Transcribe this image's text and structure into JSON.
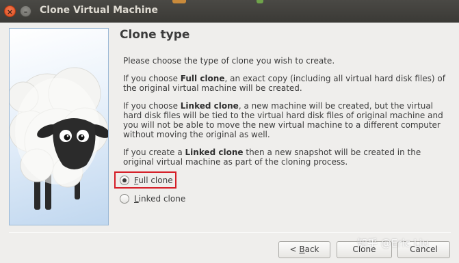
{
  "window": {
    "title": "Clone Virtual Machine",
    "close_glyph": "×",
    "minimize_glyph": "–"
  },
  "heading": "Clone type",
  "paragraphs": {
    "intro": "Please choose the type of clone you wish to create.",
    "full_prefix": "If you choose ",
    "full_term": "Full clone",
    "full_suffix": ", an exact copy (including all virtual hard disk files) of the original virtual machine will be created.",
    "linked_prefix": "If you choose ",
    "linked_term": "Linked clone",
    "linked_suffix": ", a new machine will be created, but the virtual hard disk files will be tied to the virtual hard disk files of original machine and you will not be able to move the new virtual machine to a different computer without moving the original as well.",
    "snapshot_prefix": "If you create a ",
    "snapshot_term": "Linked clone",
    "snapshot_suffix": " then a new snapshot will be created in the original virtual machine as part of the cloning process."
  },
  "options": {
    "full": {
      "label_mnemonic": "F",
      "label_rest": "ull clone",
      "selected": true
    },
    "linked": {
      "label_mnemonic": "L",
      "label_rest": "inked clone",
      "selected": false
    }
  },
  "buttons": {
    "back_prefix": "< ",
    "back_mnemonic": "B",
    "back_rest": "ack",
    "clone": "Clone",
    "cancel": "Cancel"
  },
  "watermark": "知乎 @Eric Liu",
  "icons": {
    "close": "close-icon",
    "minimize": "minimize-icon",
    "wizard_image": "sheep-illustration"
  },
  "colors": {
    "titlebar": "#3b3a36",
    "close_button": "#de4d1d",
    "focus_highlight": "#d51d26"
  }
}
